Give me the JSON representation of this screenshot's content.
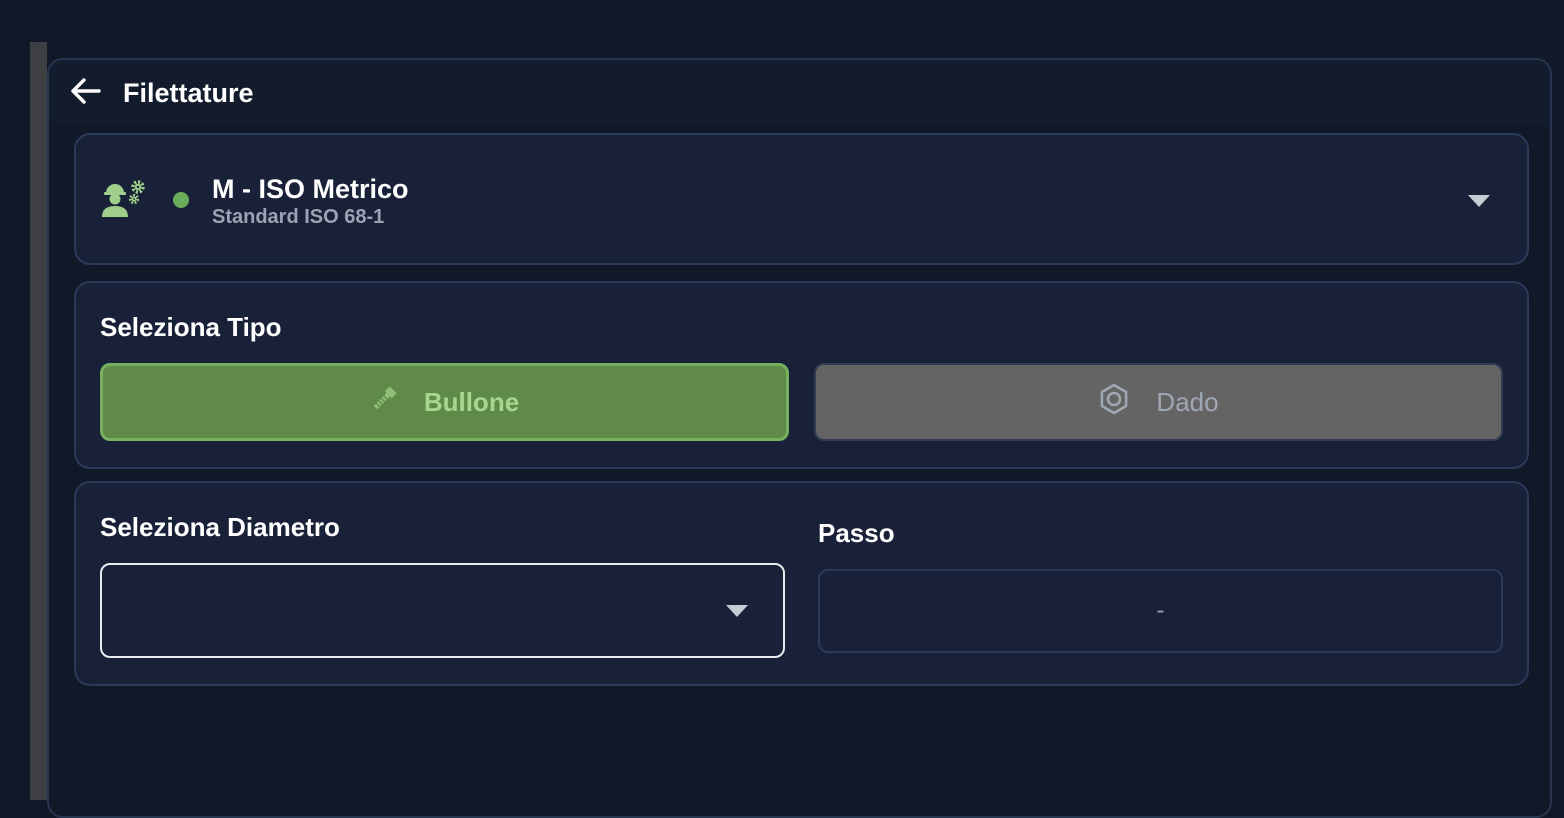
{
  "header": {
    "title": "Filettature"
  },
  "standard": {
    "name": "M - ISO Metrico",
    "subtitle": "Standard ISO 68-1",
    "status_color": "#6cab5c"
  },
  "type_section": {
    "label": "Seleziona Tipo",
    "options": [
      {
        "label": "Bullone",
        "icon": "bolt-icon",
        "selected": true
      },
      {
        "label": "Dado",
        "icon": "hex-nut-icon",
        "selected": false
      }
    ]
  },
  "diameter_section": {
    "label": "Seleziona Diametro",
    "selected_value": ""
  },
  "pitch_section": {
    "label": "Passo",
    "value": "-"
  },
  "colors": {
    "accent_green": "#5f8a48",
    "background": "#111827",
    "card": "#182137"
  }
}
